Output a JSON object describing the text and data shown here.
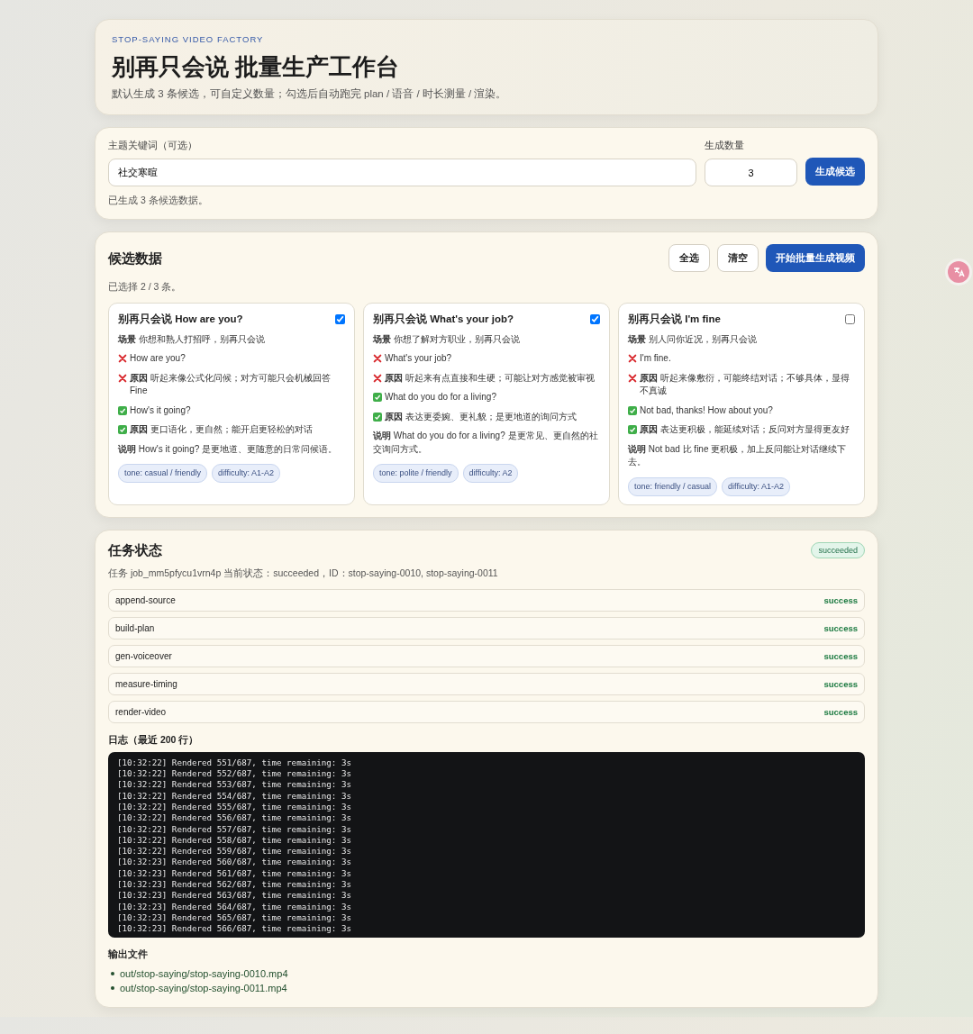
{
  "header": {
    "eyebrow": "STOP-SAYING VIDEO FACTORY",
    "title": "别再只会说 批量生产工作台",
    "subtitle": "默认生成 3 条候选，可自定义数量；勾选后自动跑完 plan / 语音 / 时长测量 / 渲染。"
  },
  "generator": {
    "keyword_label": "主题关键词（可选）",
    "keyword_value": "社交寒暄",
    "count_label": "生成数量",
    "count_value": "3",
    "button": "生成候选",
    "status": "已生成 3 条候选数据。"
  },
  "candidates": {
    "title": "候选数据",
    "buttons": [
      {
        "label": "全选",
        "kind": "secondary"
      },
      {
        "label": "清空",
        "kind": "secondary"
      },
      {
        "label": "开始批量生成视频",
        "kind": "primary"
      }
    ],
    "selection": "已选择 2 / 3 条。",
    "cards": [
      {
        "title": "别再只会说 How are you?",
        "checked": true,
        "lines": [
          {
            "kind": "plain",
            "text": "**场景** 你想和熟人打招呼，别再只会说"
          },
          {
            "kind": "wrong",
            "text": "How are you?"
          },
          {
            "kind": "wrong",
            "text": "**原因** 听起来像公式化问候；对方可能只会机械回答 Fine"
          },
          {
            "kind": "right",
            "text": "How's it going?"
          },
          {
            "kind": "right",
            "text": "**原因** 更口语化，更自然；能开启更轻松的对话"
          },
          {
            "kind": "plain",
            "text": "**说明** How's it going? 是更地道、更随意的日常问候语。"
          }
        ],
        "tags": [
          "tone: casual / friendly",
          "difficulty: A1-A2"
        ]
      },
      {
        "title": "别再只会说 What's your job?",
        "checked": true,
        "lines": [
          {
            "kind": "plain",
            "text": "**场景** 你想了解对方职业，别再只会说"
          },
          {
            "kind": "wrong",
            "text": "What's your job?"
          },
          {
            "kind": "wrong",
            "text": "**原因** 听起来有点直接和生硬；可能让对方感觉被审视"
          },
          {
            "kind": "right",
            "text": "What do you do for a living?"
          },
          {
            "kind": "right",
            "text": "**原因** 表达更委婉、更礼貌；是更地道的询问方式"
          },
          {
            "kind": "plain",
            "text": "**说明** What do you do for a living? 是更常见、更自然的社交询问方式。"
          }
        ],
        "tags": [
          "tone: polite / friendly",
          "difficulty: A2"
        ]
      },
      {
        "title": "别再只会说 I'm fine",
        "checked": false,
        "lines": [
          {
            "kind": "plain",
            "text": "**场景** 别人问你近况，别再只会说"
          },
          {
            "kind": "wrong",
            "text": "I'm fine."
          },
          {
            "kind": "wrong",
            "text": "**原因** 听起来像敷衍，可能终结对话；不够具体，显得不真诚"
          },
          {
            "kind": "right",
            "text": "Not bad, thanks! How about you?"
          },
          {
            "kind": "right",
            "text": "**原因** 表达更积极，能延续对话；反问对方显得更友好"
          },
          {
            "kind": "plain",
            "text": "**说明** Not bad 比 fine 更积极，加上反问能让对话继续下去。"
          }
        ],
        "tags": [
          "tone: friendly / casual",
          "difficulty: A1-A2"
        ]
      }
    ]
  },
  "job": {
    "title": "任务状态",
    "badge": "succeeded",
    "summary": "任务 job_mm5pfycu1vrn4p 当前状态：succeeded，ID：stop-saying-0010, stop-saying-0011",
    "steps": [
      {
        "name": "append-source",
        "status": "success"
      },
      {
        "name": "build-plan",
        "status": "success"
      },
      {
        "name": "gen-voiceover",
        "status": "success"
      },
      {
        "name": "measure-timing",
        "status": "success"
      },
      {
        "name": "render-video",
        "status": "success"
      }
    ],
    "log_title": "日志（最近 200 行）",
    "log": [
      "[10:32:22] Rendered 551/687, time remaining: 3s",
      "[10:32:22] Rendered 552/687, time remaining: 3s",
      "[10:32:22] Rendered 553/687, time remaining: 3s",
      "[10:32:22] Rendered 554/687, time remaining: 3s",
      "[10:32:22] Rendered 555/687, time remaining: 3s",
      "[10:32:22] Rendered 556/687, time remaining: 3s",
      "[10:32:22] Rendered 557/687, time remaining: 3s",
      "[10:32:22] Rendered 558/687, time remaining: 3s",
      "[10:32:22] Rendered 559/687, time remaining: 3s",
      "[10:32:23] Rendered 560/687, time remaining: 3s",
      "[10:32:23] Rendered 561/687, time remaining: 3s",
      "[10:32:23] Rendered 562/687, time remaining: 3s",
      "[10:32:23] Rendered 563/687, time remaining: 3s",
      "[10:32:23] Rendered 564/687, time remaining: 3s",
      "[10:32:23] Rendered 565/687, time remaining: 3s",
      "[10:32:23] Rendered 566/687, time remaining: 3s"
    ],
    "outputs_title": "输出文件",
    "outputs": [
      "out/stop-saying/stop-saying-0010.mp4",
      "out/stop-saying/stop-saying-0011.mp4"
    ]
  }
}
